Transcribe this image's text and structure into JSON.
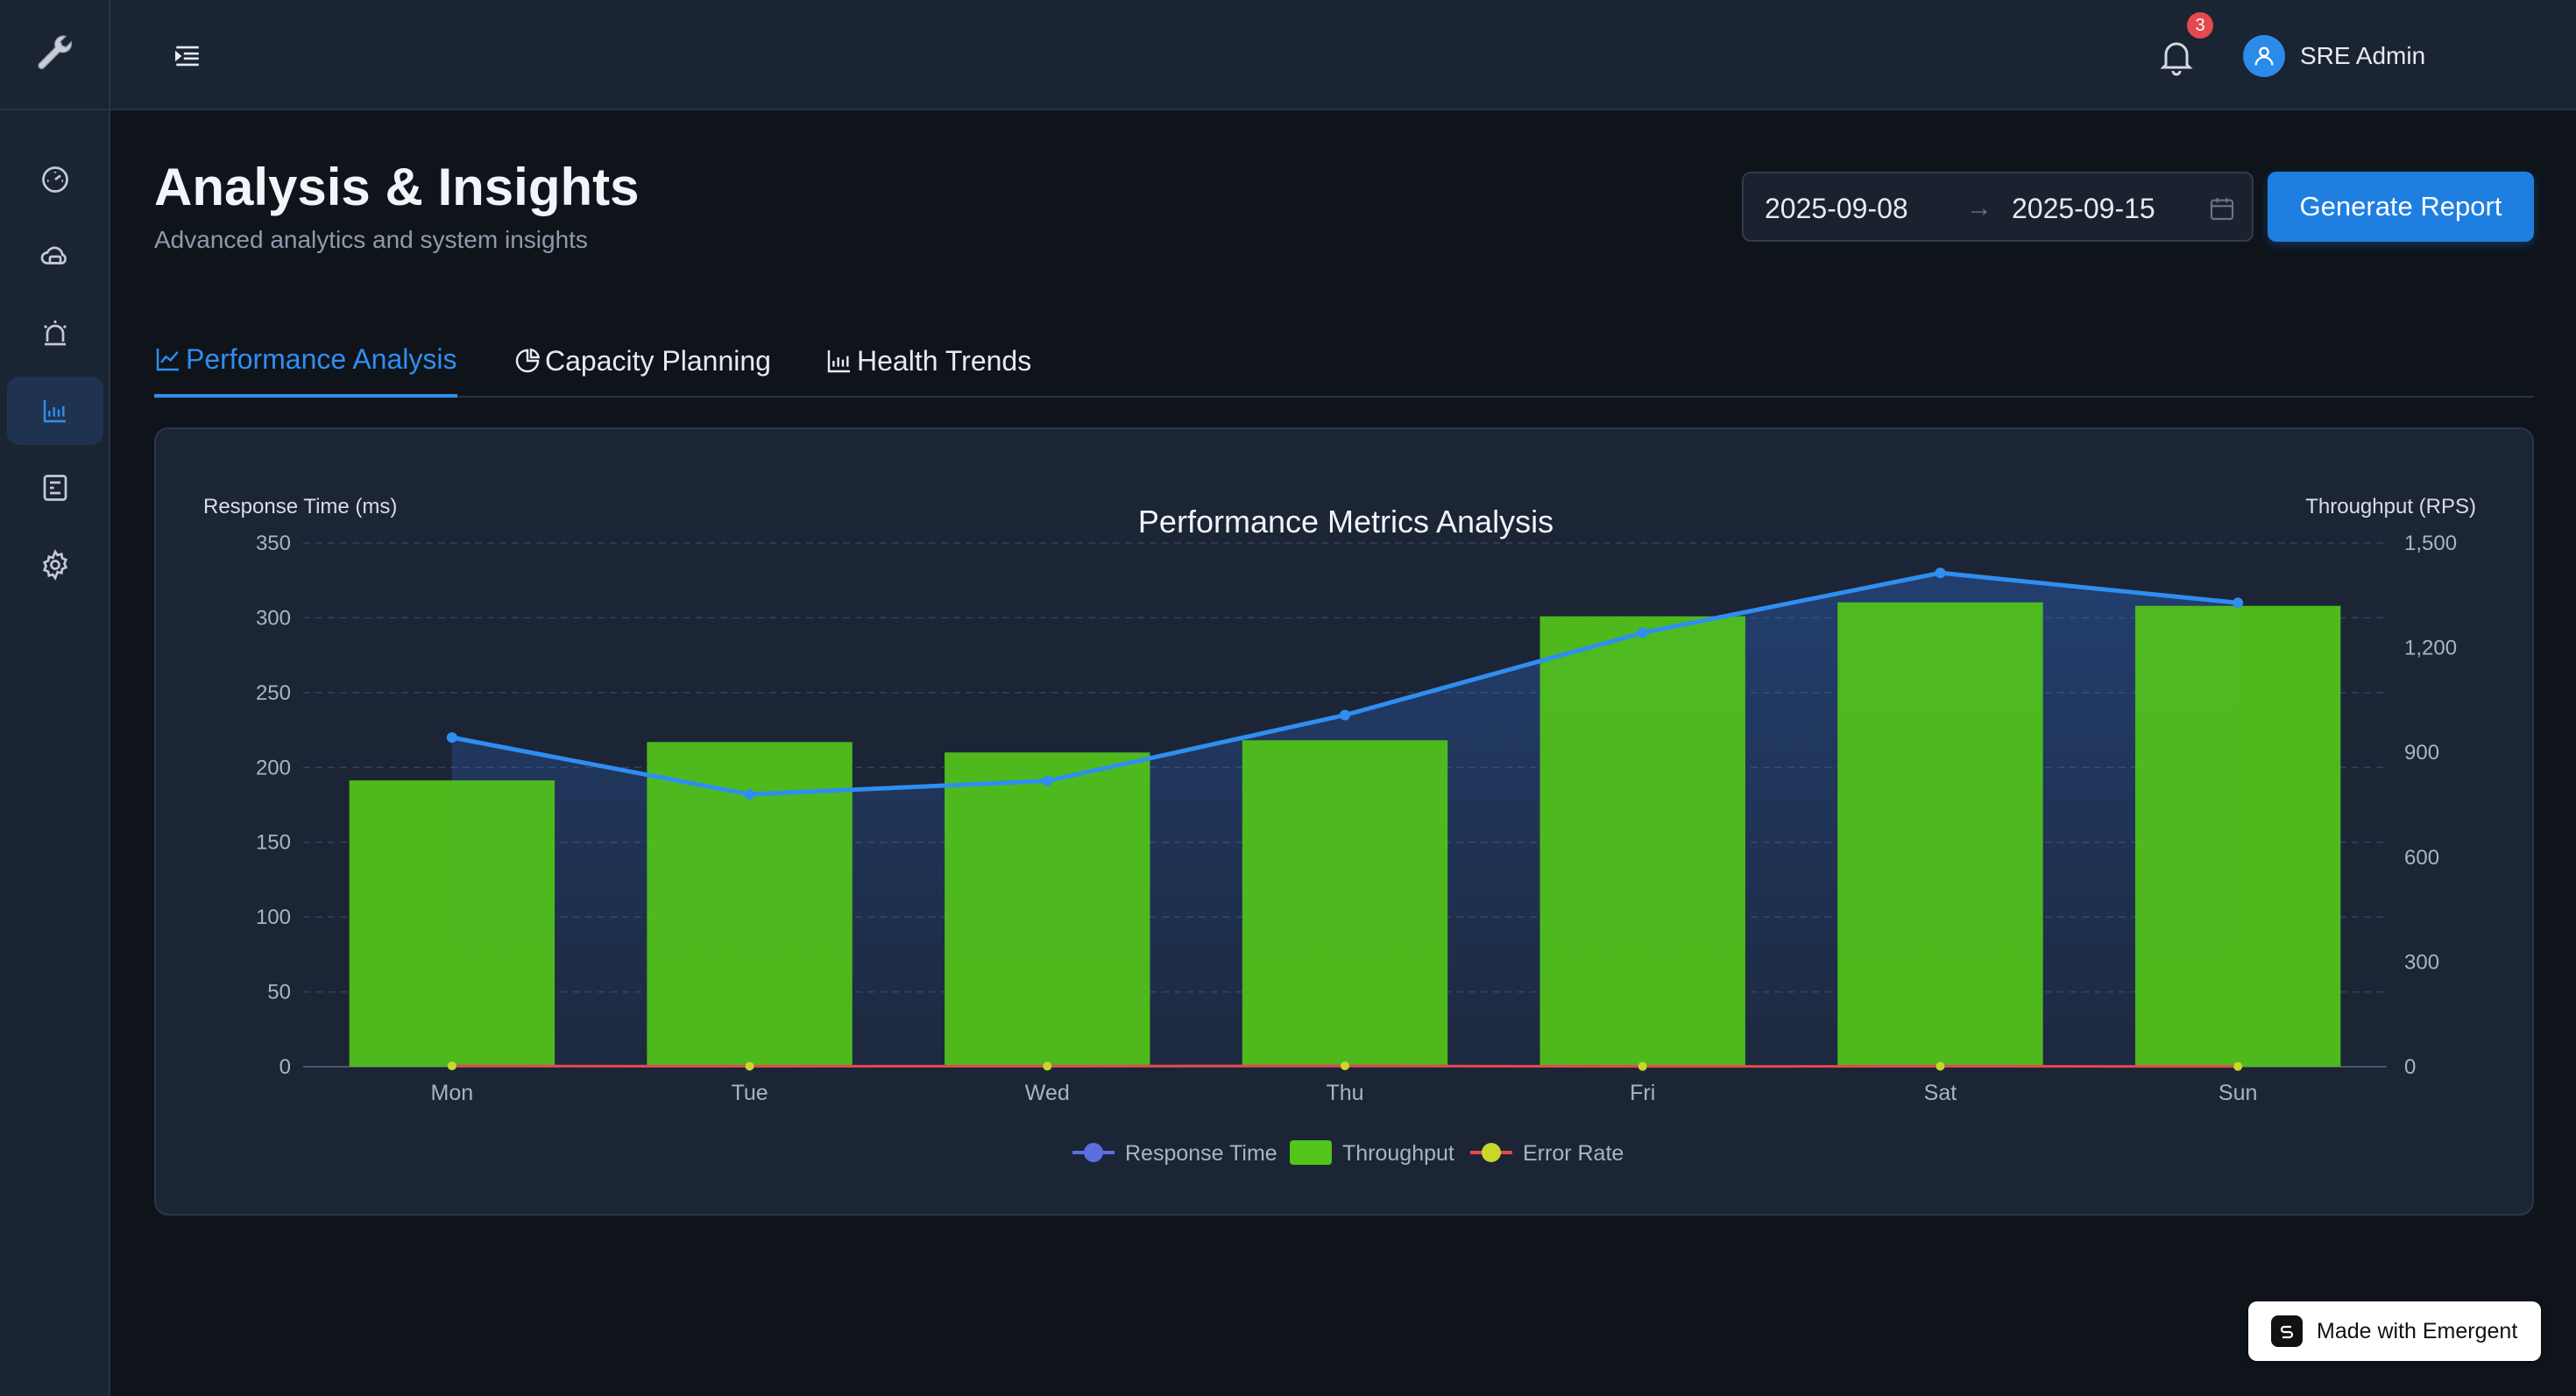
{
  "app": {
    "logo_icon": "wrench-icon",
    "accent_color": "#2f8ef0"
  },
  "sidebar": {
    "items": [
      {
        "icon": "dashboard-gauge-icon",
        "active": false
      },
      {
        "icon": "cloud-services-icon",
        "active": false
      },
      {
        "icon": "alarm-siren-icon",
        "active": false
      },
      {
        "icon": "bar-chart-icon",
        "active": true
      },
      {
        "icon": "report-document-icon",
        "active": false
      },
      {
        "icon": "gear-icon",
        "active": false
      }
    ]
  },
  "topbar": {
    "notifications_count": "3",
    "user_name": "SRE Admin"
  },
  "header": {
    "title": "Analysis & Insights",
    "subtitle": "Advanced analytics and system insights",
    "date_start": "2025-09-08",
    "date_arrow": "→",
    "date_end": "2025-09-15",
    "generate_label": "Generate Report"
  },
  "tabs": [
    {
      "label": "Performance Analysis",
      "icon": "line-chart-icon",
      "active": true
    },
    {
      "label": "Capacity Planning",
      "icon": "pie-chart-icon",
      "active": false
    },
    {
      "label": "Health Trends",
      "icon": "bar-chart-icon",
      "active": false
    }
  ],
  "chart_data": {
    "type": "bar",
    "title": "Performance Metrics Analysis",
    "ylabel_left": "Response Time (ms)",
    "ylabel_right": "Throughput (RPS)",
    "categories": [
      "Mon",
      "Tue",
      "Wed",
      "Thu",
      "Fri",
      "Sat",
      "Sun"
    ],
    "ylim_left": [
      0,
      350
    ],
    "yticks_left": [
      0,
      50,
      100,
      150,
      200,
      250,
      300,
      350
    ],
    "ylim_right": [
      0,
      1500
    ],
    "yticks_right": [
      "0",
      "300",
      "600",
      "900",
      "1,200",
      "1,500"
    ],
    "series": [
      {
        "name": "Response Time",
        "type": "line",
        "axis": "left",
        "color": "#2f8ef0",
        "values": [
          220,
          182,
          191,
          235,
          290,
          330,
          310
        ]
      },
      {
        "name": "Throughput",
        "type": "bar",
        "axis": "right",
        "color": "#52c41a",
        "values": [
          820,
          930,
          900,
          935,
          1290,
          1330,
          1320
        ]
      },
      {
        "name": "Error Rate",
        "type": "line",
        "axis": "left",
        "color": "#e5484d",
        "values": [
          0.5,
          0.3,
          0.4,
          0.6,
          0.2,
          0.3,
          0.2
        ]
      }
    ],
    "grid": true,
    "legend_position": "bottom"
  },
  "footer": {
    "made_with": "Made with Emergent"
  }
}
